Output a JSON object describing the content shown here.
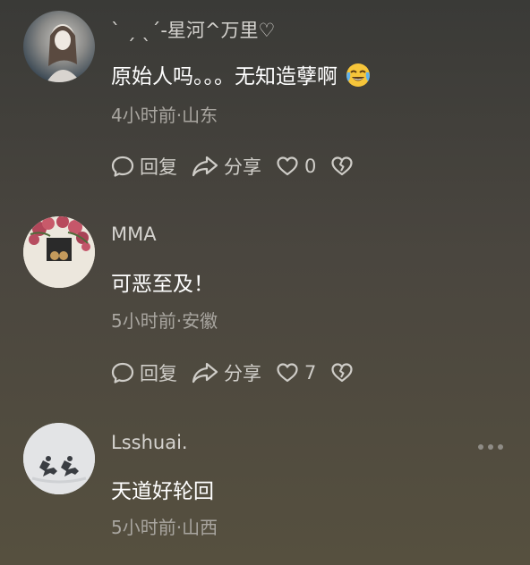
{
  "comments": [
    {
      "username": "` ˏ ˎ´-星河^万里♡",
      "text": "原始人吗。。。无知造孽啊",
      "meta": "4小时前·山东",
      "reply_label": "回复",
      "share_label": "分享",
      "like_count": "0",
      "emoji": "crying-laughing-emoji"
    },
    {
      "username": "MMA",
      "text": "可恶至及！",
      "meta": "5小时前·安徽",
      "reply_label": "回复",
      "share_label": "分享",
      "like_count": "7"
    },
    {
      "username": "Lsshuai.",
      "text": "天道好轮回",
      "meta": "5小时前·山西"
    }
  ],
  "icons": {
    "reply": "reply-icon",
    "share": "share-icon",
    "like": "heart-icon",
    "dislike": "broken-heart-icon",
    "more": "more-dots-icon"
  },
  "colors": {
    "background_top": "#3a3a37",
    "background_bottom": "#56503f",
    "username": "#d5d3cf",
    "text": "#ffffff",
    "meta": "#a9a6a0"
  }
}
